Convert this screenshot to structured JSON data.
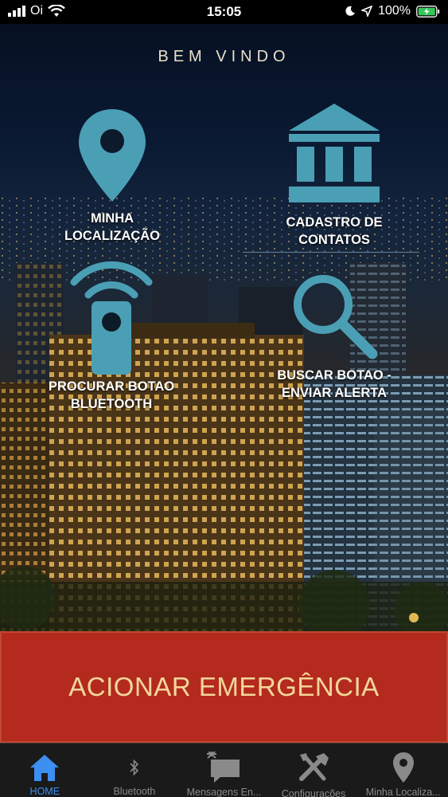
{
  "status": {
    "carrier": "Oi",
    "time": "15:05",
    "battery": "100%"
  },
  "welcome": "BEM VINDO",
  "tiles": [
    {
      "label_line1": "MINHA",
      "label_line2": "LOCALIZAÇÃO",
      "icon": "location-pin-icon"
    },
    {
      "label_line1": "CADASTRO DE",
      "label_line2": "CONTATOS",
      "icon": "bank-icon"
    },
    {
      "label_line1": "PROCURAR BOTAO",
      "label_line2": "BLUETOOTH",
      "icon": "bluetooth-button-icon"
    },
    {
      "label_line1": "BUSCAR BOTAO -",
      "label_line2": "ENVIAR ALERTA",
      "icon": "search-icon"
    }
  ],
  "emergency_label": "ACIONAR EMERGÊNCIA",
  "tabs": [
    {
      "label": "HOME",
      "icon": "home-icon",
      "active": true
    },
    {
      "label": "Bluetooth",
      "icon": "bluetooth-icon",
      "active": false
    },
    {
      "label": "Mensagens En...",
      "icon": "messages-icon",
      "active": false
    },
    {
      "label": "Configurações",
      "icon": "tools-icon",
      "active": false
    },
    {
      "label": "Minha Localiza...",
      "icon": "location-pin-icon",
      "active": false
    }
  ],
  "colors": {
    "accent": "#4b9fb5",
    "emergency": "#b42a1f",
    "emergency_text": "#f3d79a",
    "tab_active": "#3d8ff2",
    "tab_inactive": "#8a8a8a"
  }
}
